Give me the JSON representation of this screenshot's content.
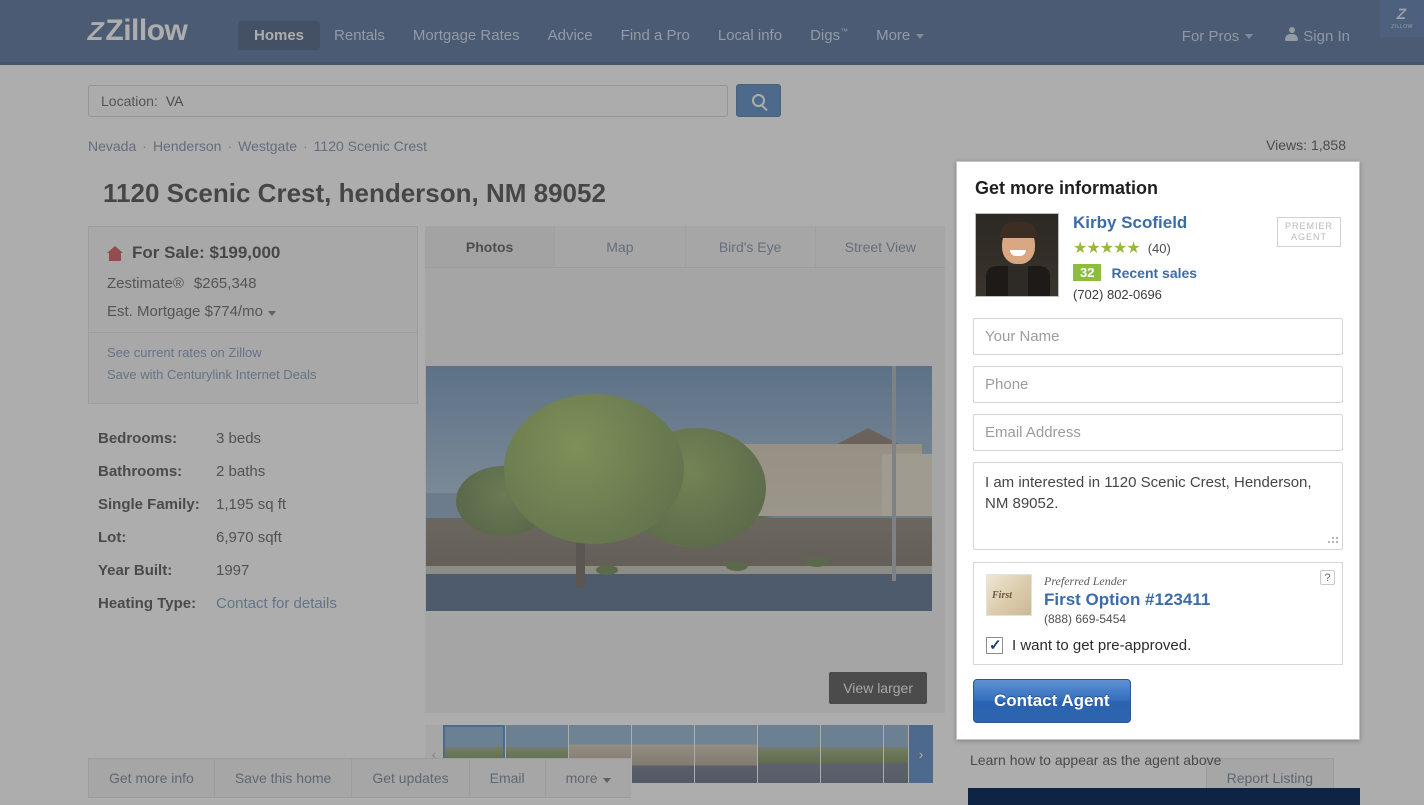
{
  "nav": {
    "logo": "Zillow",
    "items": [
      {
        "label": "Homes",
        "active": true
      },
      {
        "label": "Rentals",
        "active": false
      },
      {
        "label": "Mortgage Rates",
        "active": false
      },
      {
        "label": "Advice",
        "active": false
      },
      {
        "label": "Find a Pro",
        "active": false
      },
      {
        "label": "Local info",
        "active": false
      },
      {
        "label": "Digs",
        "sup": "™",
        "active": false
      },
      {
        "label": "More",
        "caret": true,
        "active": false
      }
    ],
    "for_pros": "For Pros",
    "sign_in": "Sign In",
    "corner_badge": "Zillow"
  },
  "search": {
    "label": "Location:",
    "value": "VA",
    "icon": "search-icon"
  },
  "breadcrumb": [
    "Nevada",
    "Henderson",
    "Westgate",
    "1120 Scenic Crest"
  ],
  "listing": {
    "title": "1120 Scenic Crest, henderson, NM 89052",
    "status_label": "For Sale:",
    "price": "$199,000",
    "zestimate_label": "Zestimate®",
    "zestimate_value": "$265,348",
    "mortgage_label": "Est. Mortgage",
    "mortgage_value": "$774/mo",
    "links": [
      "See current rates on Zillow",
      "Save with Centurylink Internet Deals"
    ],
    "facts": [
      {
        "key": "Bedrooms:",
        "value": "3 beds",
        "link": false
      },
      {
        "key": "Bathrooms:",
        "value": "2 baths",
        "link": false
      },
      {
        "key": "Single Family:",
        "value": "1,195 sq ft",
        "link": false
      },
      {
        "key": "Lot:",
        "value": "6,970 sqft",
        "link": false
      },
      {
        "key": "Year Built:",
        "value": "1997",
        "link": false
      },
      {
        "key": "Heating Type:",
        "value": "Contact for details",
        "link": true
      }
    ]
  },
  "media": {
    "tabs": [
      {
        "label": "Photos",
        "active": true
      },
      {
        "label": "Map",
        "active": false
      },
      {
        "label": "Bird's Eye",
        "active": false
      },
      {
        "label": "Street View",
        "active": false
      }
    ],
    "view_larger": "View larger",
    "prev_icon": "chevron-left-icon",
    "next_icon": "chevron-right-icon",
    "thumb_count": 7
  },
  "actions": {
    "buttons": [
      "Get more info",
      "Save this home",
      "Get updates",
      "Email",
      "more"
    ],
    "more_caret": true,
    "report": "Report Listing"
  },
  "modal": {
    "views_label": "Views:",
    "views_count": "1,858",
    "title": "Get more information",
    "agent": {
      "name": "Kirby Scofield",
      "stars": 5,
      "rating_count": "(40)",
      "recent_sales_count": "32",
      "recent_sales_label": "Recent sales",
      "phone": "(702) 802-0696",
      "premier_line1": "PREMIER",
      "premier_line2": "AGENT"
    },
    "form": {
      "name_placeholder": "Your Name",
      "phone_placeholder": "Phone",
      "email_placeholder": "Email Address",
      "message_value": "I am interested in 1120 Scenic Crest, Henderson, NM 89052."
    },
    "lender": {
      "preferred_label": "Preferred Lender",
      "name": "First Option #123411",
      "phone": "(888) 669-5454",
      "help_icon": "?",
      "checkbox_checked": true,
      "checkbox_label": "I want to get pre-approved."
    },
    "submit": "Contact Agent",
    "footer_note": "Learn how to appear as the agent above"
  },
  "colors": {
    "nav_blue": "#24497f",
    "accent_blue": "#2a6cb5",
    "link_blue": "#3c6ca8",
    "star_green": "#9cb83c",
    "badge_green": "#8dbd3f",
    "price_red": "#c42e2e"
  }
}
